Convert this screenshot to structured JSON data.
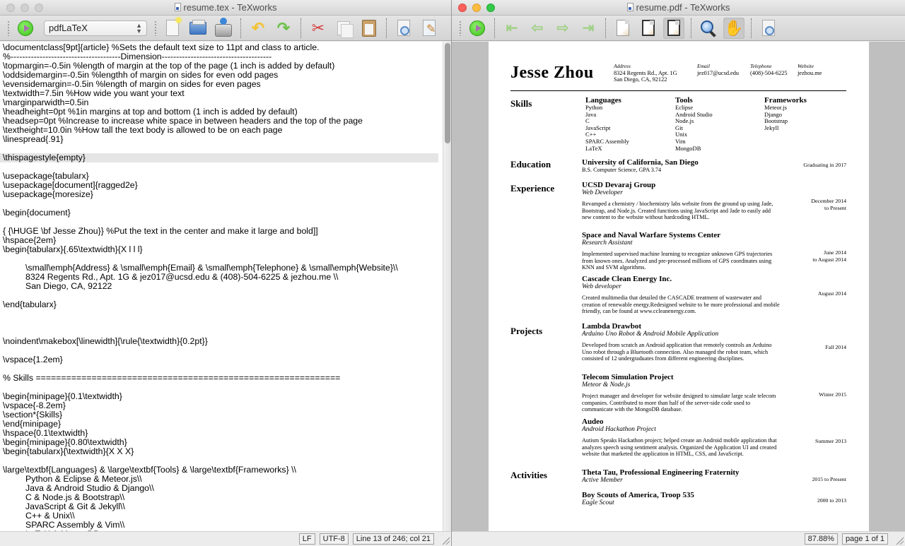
{
  "editor_window": {
    "title": "resume.tex - TeXworks",
    "toolbar": {
      "typeset_engine": "pdfLaTeX",
      "buttons": [
        "typeset",
        "new",
        "open",
        "save",
        "undo",
        "redo",
        "cut",
        "copy",
        "paste",
        "find",
        "replace"
      ]
    },
    "code_lines": [
      "\\documentclass[9pt]{article} %Sets the default text size to 11pt and class to article.",
      "%--------------------------------------Dimension--------------------------------------",
      "\\topmargin=-0.5in %length of margin at the top of the page (1 inch is added by default)",
      "\\oddsidemargin=-0.5in %lengthh of margin on sides for even odd pages",
      "\\evensidemargin=-0.5in %length of margin on sides for even pages",
      "\\textwidth=7.5in %How wide you want your text",
      "\\marginparwidth=0.5in",
      "\\headheight=0pt %1in margins at top and bottom (1 inch is added by default)",
      "\\headsep=0pt %Increase to increase white space in between headers and the top of the page",
      "\\textheight=10.0in %How tall the text body is allowed to be on each page",
      "\\linespread{.91}",
      "",
      "\\thispagestyle{empty}",
      "",
      "\\usepackage{tabularx}",
      "\\usepackage[document]{ragged2e}",
      "\\usepackage{moresize}",
      "",
      "\\begin{document}",
      "",
      "{ {\\HUGE \\bf Jesse Zhou}} %Put the text in the center and make it large and bold]]",
      "\\hspace{2em}",
      "\\begin{tabularx}{.65\\textwidth}{X l l l}",
      "",
      "\\small\\emph{Address} & \\small\\emph{Email} & \\small\\emph{Telephone} & \\small\\emph{Website}\\\\",
      "8324 Regents Rd., Apt. 1G & jez017@ucsd.edu & (408)-504-6225 & jezhou.me \\\\",
      "San Diego, CA, 92122",
      "",
      "\\end{tabularx}",
      "",
      "",
      "",
      "\\noindent\\makebox[\\linewidth]{\\rule{\\textwidth}{0.2pt}}",
      "",
      "\\vspace{1.2em}",
      "",
      "% Skills ============================================================",
      "",
      "\\begin{minipage}{0.1\\textwidth}",
      "\\vspace{-8.2em}",
      "\\section*{Skills}",
      "\\end{minipage}",
      "\\hspace{0.1\\textwidth}",
      "\\begin{minipage}{0.80\\textwidth}",
      "\\begin{tabularx}{\\textwidth}{X X X}",
      "",
      "\\large\\textbf{Languages} & \\large\\textbf{Tools} & \\large\\textbf{Frameworks} \\\\",
      "Python & Eclipse & Meteor.js\\\\",
      "Java & Android Studio & Django\\\\",
      "C & Node.js & Bootstrap\\\\",
      "JavaScript & Git & Jekyll\\\\",
      "C++ & Unix\\\\",
      "SPARC Assembly & Vim\\\\",
      "LaTeX & MongoDB"
    ],
    "indented_lines": [
      24,
      25,
      26,
      47,
      48,
      49,
      50,
      51,
      52,
      53,
      54
    ],
    "current_line_index": 12,
    "status": {
      "line_ending": "LF",
      "encoding": "UTF-8",
      "position": "Line 13 of 246; col 21"
    }
  },
  "viewer_window": {
    "title": "resume.pdf - TeXworks",
    "toolbar": {
      "buttons": [
        "typeset",
        "first-page",
        "previous-page",
        "next-page",
        "last-page",
        "actual-size",
        "fit-width",
        "fit-window",
        "magnify",
        "scroll-hand",
        "find"
      ],
      "active": [
        "fit-window",
        "scroll-hand"
      ]
    },
    "status": {
      "zoom": "87.88%",
      "page": "page 1 of 1"
    }
  },
  "resume": {
    "name": "Jesse Zhou",
    "contact": [
      {
        "label": "Address",
        "lines": [
          "8324 Regents Rd., Apt. 1G",
          "San Diego, CA, 92122"
        ]
      },
      {
        "label": "Email",
        "lines": [
          "jez017@ucsd.edu"
        ]
      },
      {
        "label": "Telephone",
        "lines": [
          "(408)-504-6225"
        ]
      },
      {
        "label": "Website",
        "lines": [
          "jezhou.me"
        ]
      }
    ],
    "skills": {
      "title": "Skills",
      "columns": [
        {
          "heading": "Languages",
          "items": [
            "Python",
            "Java",
            "C",
            "JavaScript",
            "C++",
            "SPARC Assembly",
            "LaTeX"
          ]
        },
        {
          "heading": "Tools",
          "items": [
            "Eclipse",
            "Android Studio",
            "Node.js",
            "Git",
            "Unix",
            "Vim",
            "MongoDB"
          ]
        },
        {
          "heading": "Frameworks",
          "items": [
            "Meteor.js",
            "Django",
            "Bootstrap",
            "Jekyll"
          ]
        }
      ]
    },
    "education": {
      "title": "Education",
      "org": "University of California, San Diego",
      "sub": "B.S. Computer Science, GPA 3.74",
      "date": "Graduating in 2017"
    },
    "experience": {
      "title": "Experience",
      "entries": [
        {
          "org": "UCSD Devaraj Group",
          "role": "Web Developer",
          "desc": "Revamped a chemistry / biochemistry labs website from the ground up using Jade, Bootstrap, and Node.js. Created functions using JavaScript and Jade to easily add new content to the website without hardcoding HTML.",
          "date": [
            "December 2014",
            "to Present"
          ]
        },
        {
          "org": "Space and Naval Warfare Systems Center",
          "role": "Research Assistant",
          "desc": "Implemented supervised machine learning to recognize unknown GPS trajectories from known ones. Analyzed and pre-processed millions of GPS coordinates using KNN and SVM algorithms.",
          "date": [
            "June 2014",
            "to August 2014"
          ]
        },
        {
          "org": "Cascade Clean Energy Inc.",
          "role": "Web developer",
          "desc": "Created multimedia that detailed the CASCADE treatment of wastewater and creation of renewable energy.Redesigned website to be more professional and mobile friendly, can be found at www.ccleanenergy.com.",
          "date": [
            "August 2014"
          ]
        }
      ]
    },
    "projects": {
      "title": "Projects",
      "entries": [
        {
          "org": "Lambda Drawbot",
          "role": "Arduino Uno Robot & Android Mobile Application",
          "desc": "Developed from scratch an Android application that remotely controls an Arduino Uno robot through a Bluetooth connection. Also managed the robot team, which consisted of 12 undergraduates from different engineering disciplines.",
          "date": [
            "Fall 2014"
          ]
        },
        {
          "org": "Telecom Simulation Project",
          "role": "Meteor & Node.js",
          "desc": "Project manager and developer for website designed to simulate large scale telecom companies. Contributed to more than half of the server-side code used to communicate with the MongoDB database.",
          "date": [
            "Winter 2015"
          ]
        },
        {
          "org": "Audeo",
          "role": "Android Hackathon Project",
          "desc": "Autism Speaks Hackathon project; helped create an Android mobile application that analyzes speech using sentiment analysis. Organized the Application UI and created website that marketed the application in HTML, CSS, and JavaScript.",
          "date": [
            "Summer 2013"
          ]
        }
      ]
    },
    "activities": {
      "title": "Activities",
      "entries": [
        {
          "org": "Theta Tau, Professional Engineering Fraternity",
          "role": "Active Member",
          "date": [
            "2015 to Present"
          ]
        },
        {
          "org": "Boy Scouts of America, Troop 535",
          "role": "Eagle Scout",
          "date": [
            "2000 to 2013"
          ]
        }
      ]
    }
  }
}
